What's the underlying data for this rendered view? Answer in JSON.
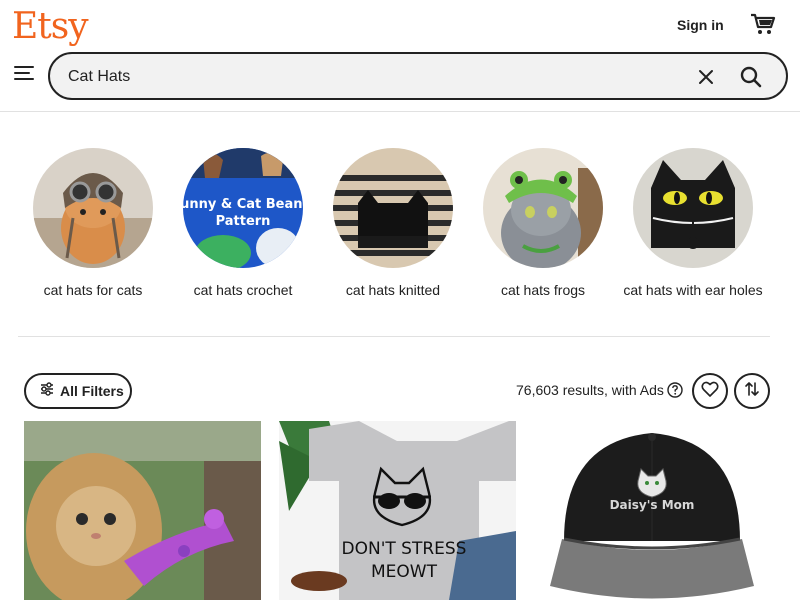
{
  "header": {
    "logo": "Etsy",
    "signin_label": "Sign in",
    "cart_icon": "shopping-cart-icon",
    "menu_icon": "hamburger-menu-icon"
  },
  "search": {
    "value": "Cat Hats",
    "clear_icon": "close-icon",
    "submit_icon": "search-icon"
  },
  "categories": [
    {
      "label": "cat hats for cats"
    },
    {
      "label": "cat hats crochet"
    },
    {
      "label": "cat hats knitted"
    },
    {
      "label": "cat hats frogs"
    },
    {
      "label": "cat hats with ear holes"
    }
  ],
  "category_image_text": "Bunny & Cat Beanie Pattern",
  "toolbar": {
    "filters_label": "All Filters",
    "results_text": "76,603 results, with Ads",
    "help_icon": "question-circle-icon",
    "favorite_icon": "heart-icon",
    "sort_icon": "sort-arrows-icon"
  },
  "listings": [
    {
      "image_text": ""
    },
    {
      "image_text_line1": "DON'T STRESS",
      "image_text_line2": "MEOWT"
    },
    {
      "image_text": "Daisy's Mom"
    }
  ],
  "colors": {
    "brand": "#f1641e",
    "text": "#222222",
    "search_bg": "#f2f2f2",
    "divider": "#e1e1e1"
  }
}
